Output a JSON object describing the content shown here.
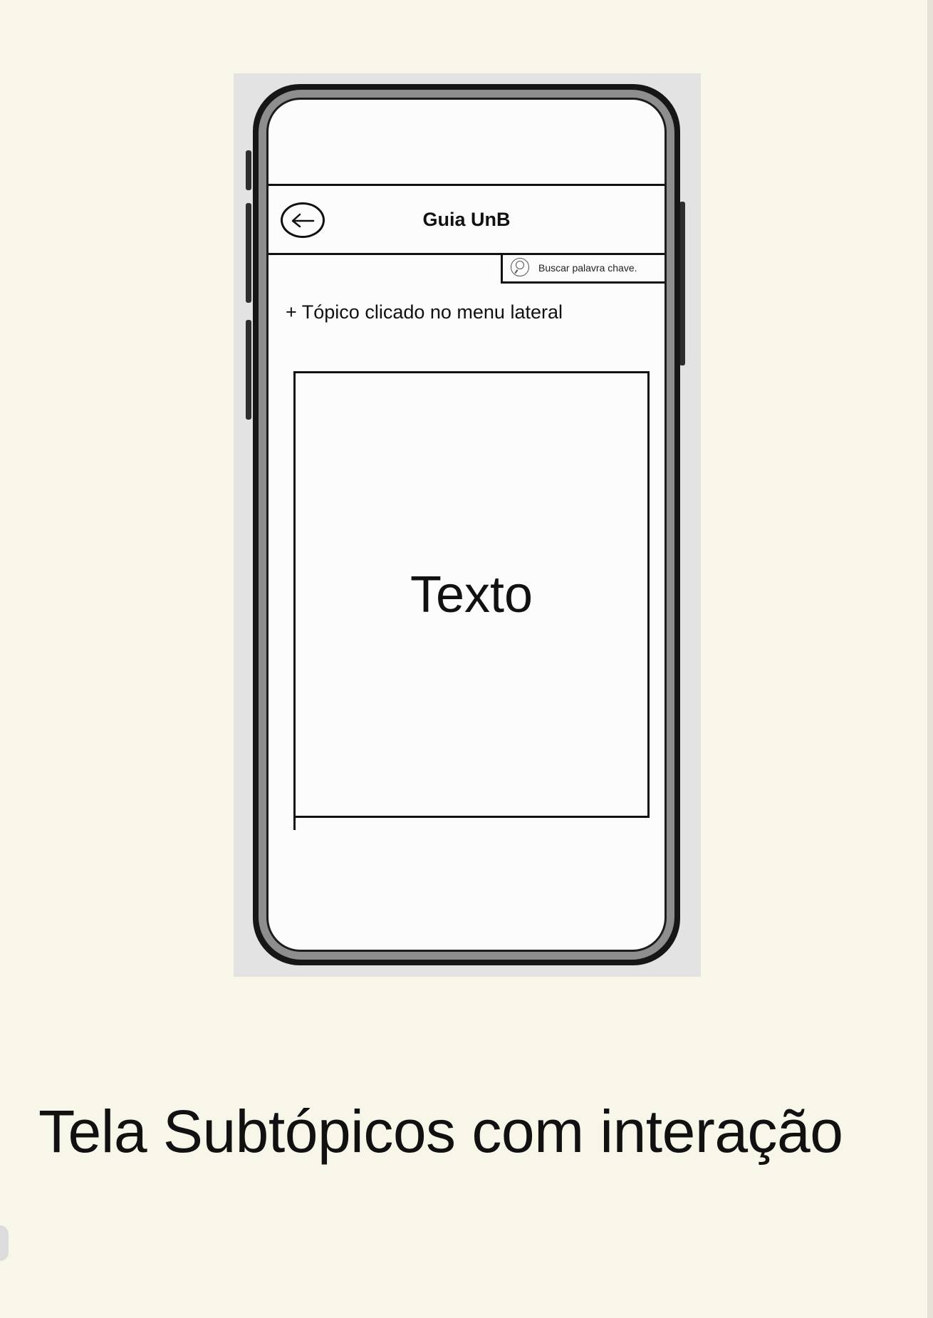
{
  "app": {
    "title": "Guia UnB"
  },
  "search": {
    "placeholder": "Buscar palavra chave."
  },
  "content": {
    "topic_heading": "+ Tópico clicado no menu lateral",
    "text_placeholder": "Texto"
  },
  "caption": "Tela Subtópicos com interação",
  "icons": {
    "back": "arrow-left-icon",
    "search": "search-icon"
  },
  "colors": {
    "background": "#f8f6e8",
    "screen": "#fcfcfc",
    "outline": "#111111"
  }
}
